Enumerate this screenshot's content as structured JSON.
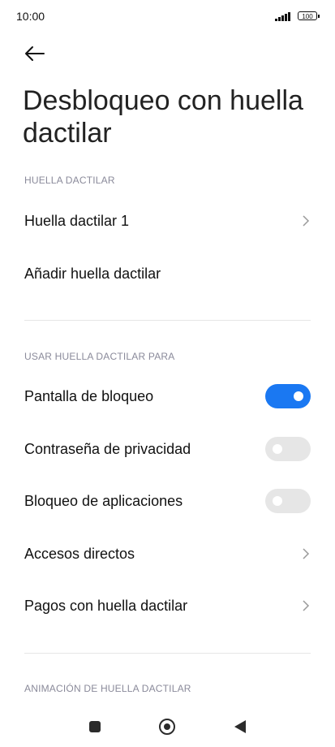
{
  "status_bar": {
    "time": "10:00",
    "battery": "100"
  },
  "page": {
    "title": "Desbloqueo con huella dactilar"
  },
  "sections": {
    "fingerprint": {
      "header": "HUELLA DACTILAR",
      "items": [
        {
          "label": "Huella dactilar 1"
        },
        {
          "label": "Añadir huella dactilar"
        }
      ]
    },
    "use_for": {
      "header": "USAR HUELLA DACTILAR PARA",
      "items": [
        {
          "label": "Pantalla de bloqueo",
          "enabled": true
        },
        {
          "label": "Contraseña de privacidad",
          "enabled": false
        },
        {
          "label": "Bloqueo de aplicaciones",
          "enabled": false
        },
        {
          "label": "Accesos directos"
        },
        {
          "label": "Pagos con huella dactilar"
        }
      ]
    },
    "animation": {
      "header": "ANIMACIÓN DE HUELLA DACTILAR"
    }
  },
  "colors": {
    "accent": "#1a78f2",
    "toggle_off": "#e6e6e6",
    "section_header": "#8a8a9a"
  },
  "icons": [
    "back-arrow-icon",
    "chevron-right-icon",
    "signal-icon",
    "battery-icon"
  ]
}
